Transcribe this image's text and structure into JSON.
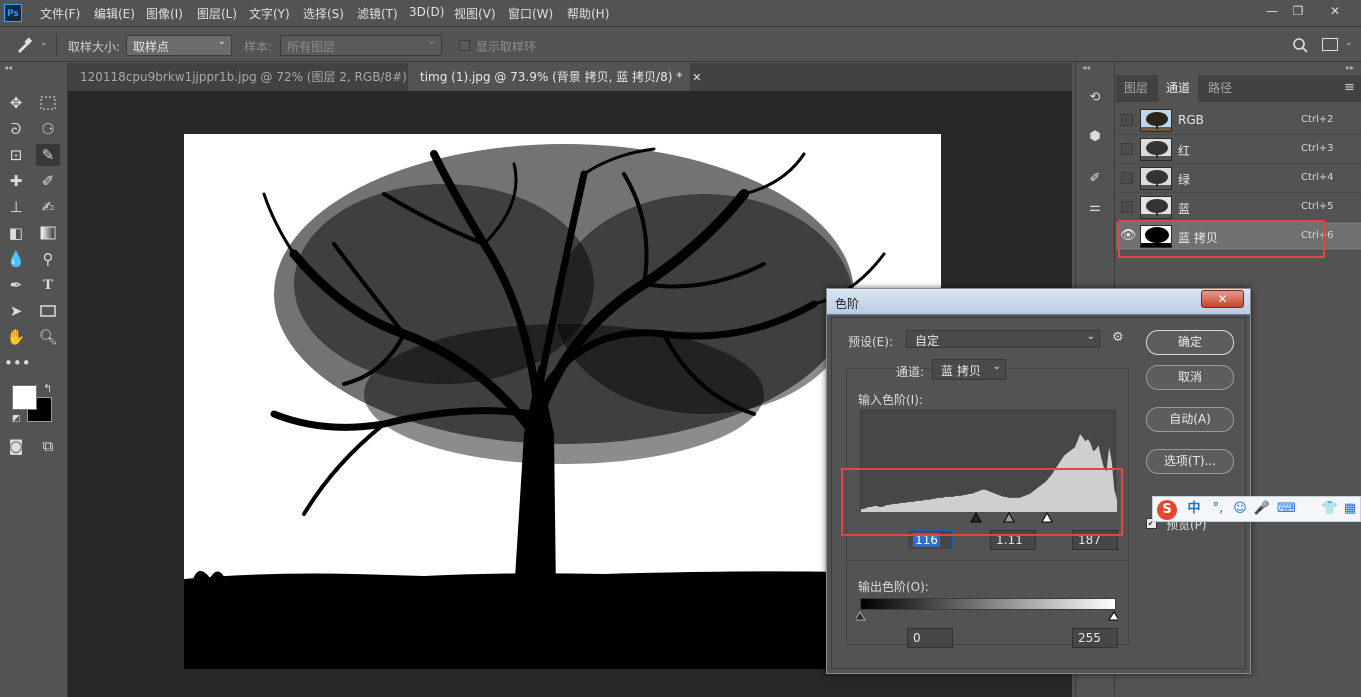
{
  "app": {
    "logo_text": "Ps",
    "menus": [
      "文件(F)",
      "编辑(E)",
      "图像(I)",
      "图层(L)",
      "文字(Y)",
      "选择(S)",
      "滤镜(T)",
      "3D(D)",
      "视图(V)",
      "窗口(W)",
      "帮助(H)"
    ],
    "window_controls": [
      "—",
      "❐",
      "✕"
    ]
  },
  "options": {
    "sample_size_label": "取样大小:",
    "sample_size_value": "取样点",
    "sample_label": "样本:",
    "sample_value": "所有图层",
    "show_ring_label": "显示取样环"
  },
  "tabs": [
    {
      "label": "120118cpu9brkw1jjppr1b.jpg @ 72% (图层 2, RGB/8#) *",
      "close": "✕"
    },
    {
      "label": "timg (1).jpg @ 73.9% (背景 拷贝, 蓝 拷贝/8) *",
      "close": "✕"
    }
  ],
  "panel": {
    "tabs": [
      "图层",
      "通道",
      "路径"
    ],
    "menu_icon": "≡",
    "channels": [
      {
        "name": "RGB",
        "shortcut": "Ctrl+2",
        "visible": false
      },
      {
        "name": "红",
        "shortcut": "Ctrl+3",
        "visible": false
      },
      {
        "name": "绿",
        "shortcut": "Ctrl+4",
        "visible": false
      },
      {
        "name": "蓝",
        "shortcut": "Ctrl+5",
        "visible": false
      },
      {
        "name": "蓝 拷贝",
        "shortcut": "Ctrl+6",
        "visible": true
      }
    ]
  },
  "levels_dialog": {
    "title": "色阶",
    "close": "✕",
    "preset_label": "预设(E):",
    "preset_value": "自定",
    "channel_label": "通道:",
    "channel_value": "蓝 拷贝",
    "input_label": "输入色阶(I):",
    "input_black": "116",
    "input_gamma": "1.11",
    "input_white": "187",
    "output_label": "输出色阶(O):",
    "output_black": "0",
    "output_white": "255",
    "buttons": {
      "ok": "确定",
      "cancel": "取消",
      "auto": "自动(A)",
      "options": "选项(T)..."
    },
    "preview_label": "预览(P)",
    "preview_checked": true,
    "histogram": [
      3,
      3,
      4,
      5,
      5,
      6,
      6,
      5,
      5,
      6,
      7,
      7,
      8,
      8,
      8,
      9,
      9,
      9,
      10,
      10,
      10,
      11,
      11,
      11,
      12,
      12,
      12,
      13,
      13,
      14,
      14,
      14,
      15,
      15,
      15,
      15,
      16,
      16,
      16,
      17,
      17,
      18,
      18,
      19,
      20,
      21,
      22,
      22,
      21,
      20,
      19,
      18,
      17,
      16,
      15,
      15,
      14,
      14,
      14,
      14,
      14,
      15,
      16,
      17,
      18,
      20,
      22,
      24,
      26,
      28,
      30,
      33,
      36,
      40,
      44,
      48,
      52,
      56,
      58,
      60,
      62,
      64,
      70,
      77,
      74,
      70,
      72,
      68,
      60,
      62,
      66,
      54,
      44,
      40,
      64,
      50,
      22,
      12
    ]
  },
  "ime": {
    "brand": "S",
    "chars": [
      "中",
      "°,",
      "☺",
      "🎤",
      "⌨",
      "👕",
      "▦"
    ]
  }
}
